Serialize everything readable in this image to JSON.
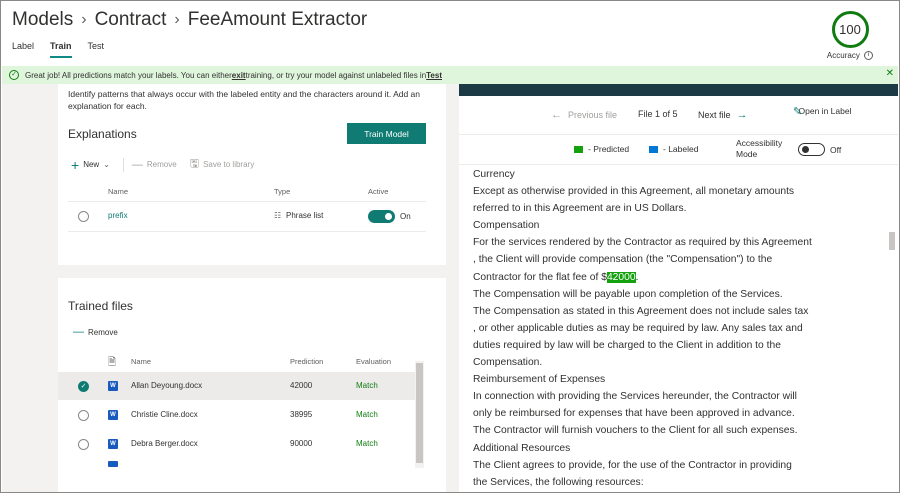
{
  "header": {
    "breadcrumb": [
      "Models",
      "Contract",
      "FeeAmount Extractor"
    ],
    "tabs": [
      "Label",
      "Train",
      "Test"
    ],
    "active_tab": "Train",
    "accuracy_value": "100",
    "accuracy_label": "Accuracy"
  },
  "banner": {
    "text_before": "Great job! All predictions match your labels. You can either ",
    "exit_link": "exit",
    "text_middle": " training, or try your model against unlabeled files in ",
    "test_link": "Test"
  },
  "explanations": {
    "intro": "Identify patterns that always occur with the labeled entity and the characters around it. Add an explanation for each.",
    "title": "Explanations",
    "train_button": "Train Model",
    "commands": {
      "new": "New",
      "remove": "Remove",
      "save": "Save to library"
    },
    "columns": {
      "name": "Name",
      "type": "Type",
      "active": "Active"
    },
    "rows": [
      {
        "name": "prefix",
        "type": "Phrase list",
        "active": "On"
      }
    ]
  },
  "trained_files": {
    "title": "Trained files",
    "remove": "Remove",
    "columns": {
      "name": "Name",
      "prediction": "Prediction",
      "evaluation": "Evaluation"
    },
    "rows": [
      {
        "name": "Allan Deyoung.docx",
        "prediction": "42000",
        "evaluation": "Match"
      },
      {
        "name": "Christie Cline.docx",
        "prediction": "38995",
        "evaluation": "Match"
      },
      {
        "name": "Debra Berger.docx",
        "prediction": "90000",
        "evaluation": "Match"
      }
    ]
  },
  "viewer": {
    "prev": "Previous file",
    "position": "File 1 of 5",
    "next": "Next file",
    "open_in_label": "Open in Label",
    "legend_predicted": "- Predicted",
    "legend_labeled": "- Labeled",
    "accessibility_mode": "Accessibility Mode",
    "accessibility_state": "Off",
    "colors": {
      "predicted": "#13a10e",
      "labeled": "#0078d4"
    },
    "lines": [
      "Currency",
      "Except as otherwise provided in this Agreement, all monetary amounts",
      "referred to in this Agreement are in US Dollars.",
      "Compensation",
      "For the services rendered by the Contractor as required by this Agreement",
      ", the Client will provide compensation (the \"Compensation\") to the",
      "Contractor for the flat fee of $",
      "The Compensation will be payable upon completion of the Services.",
      "The Compensation as stated in this Agreement does not include sales tax",
      ", or other applicable duties as may be required by law. Any sales tax and",
      "duties required by law will be charged to the Client in addition to the",
      "Compensation.",
      "Reimbursement of Expenses",
      "In connection with providing the Services hereunder, the Contractor will",
      "only be reimbursed for expenses that have been approved in advance.",
      "The Contractor will furnish vouchers to the Client for all such expenses.",
      "Additional Resources",
      "The Client agrees to provide, for the use of the Contractor in providing",
      "the Services, the following resources:"
    ],
    "highlight": "42000",
    "after_highlight": "."
  }
}
